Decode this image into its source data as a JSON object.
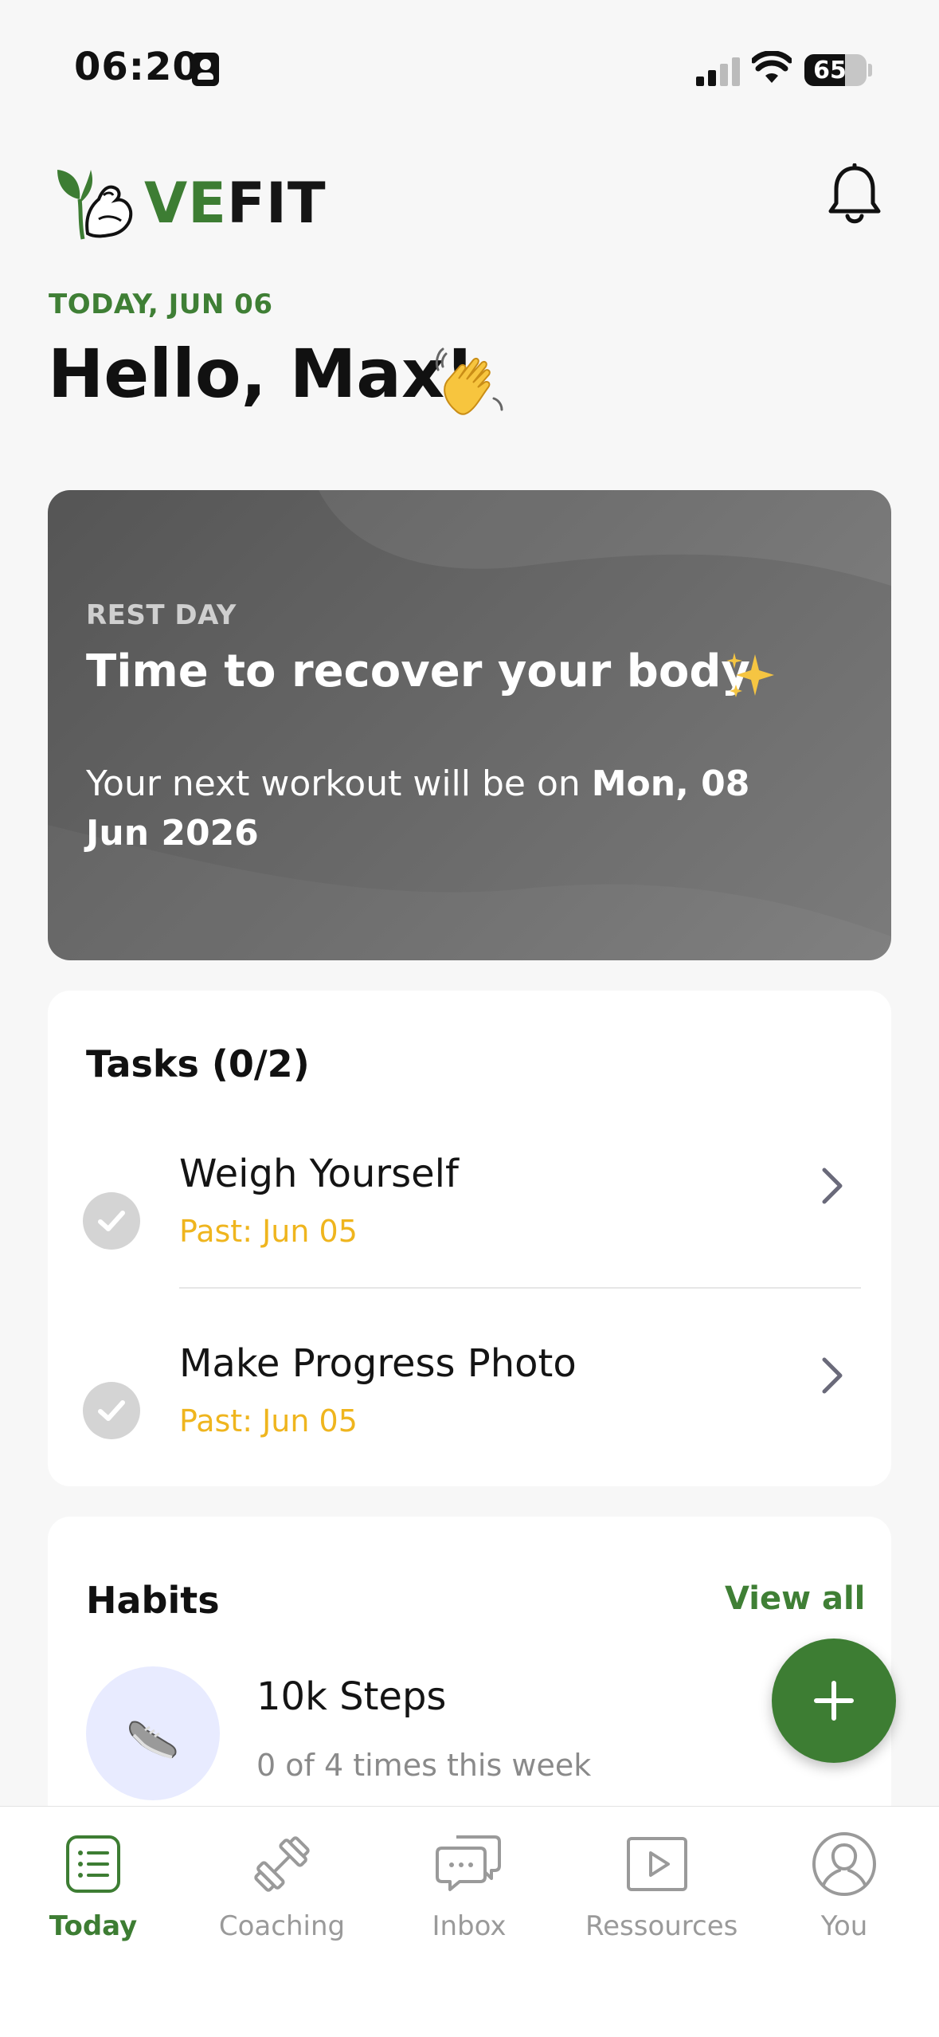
{
  "status_bar": {
    "time": "06:20",
    "battery": "65",
    "battery_level": 0.65
  },
  "header": {
    "logo_ve": "VE",
    "logo_fit": "FIT",
    "date_label": "TODAY, JUN 06",
    "greeting": "Hello, Max!"
  },
  "rest_card": {
    "tag": "REST DAY",
    "title": "Time to recover your body",
    "text_prefix": "Your next workout will be on ",
    "next_date": "Mon, 08 Jun 2026"
  },
  "tasks": {
    "title": "Tasks (0/2)",
    "items": [
      {
        "name": "Weigh Yourself",
        "due": "Past: Jun 05"
      },
      {
        "name": "Make Progress Photo",
        "due": "Past: Jun 05"
      }
    ]
  },
  "habits": {
    "title": "Habits",
    "view_all": "View all",
    "items": [
      {
        "name": "10k Steps",
        "progress": "0 of 4 times this week",
        "icon": "sneaker-icon"
      }
    ]
  },
  "tab_bar": {
    "tabs": [
      {
        "label": "Today",
        "icon": "today-list-icon",
        "active": true
      },
      {
        "label": "Coaching",
        "icon": "dumbbell-icon",
        "active": false
      },
      {
        "label": "Inbox",
        "icon": "chat-bubbles-icon",
        "active": false
      },
      {
        "label": "Ressources",
        "icon": "play-video-icon",
        "active": false
      },
      {
        "label": "You",
        "icon": "profile-icon",
        "active": false
      }
    ]
  },
  "colors": {
    "brand_green": "#3d7d33",
    "due_yellow": "#efb51e",
    "background": "#f7f7f7"
  }
}
